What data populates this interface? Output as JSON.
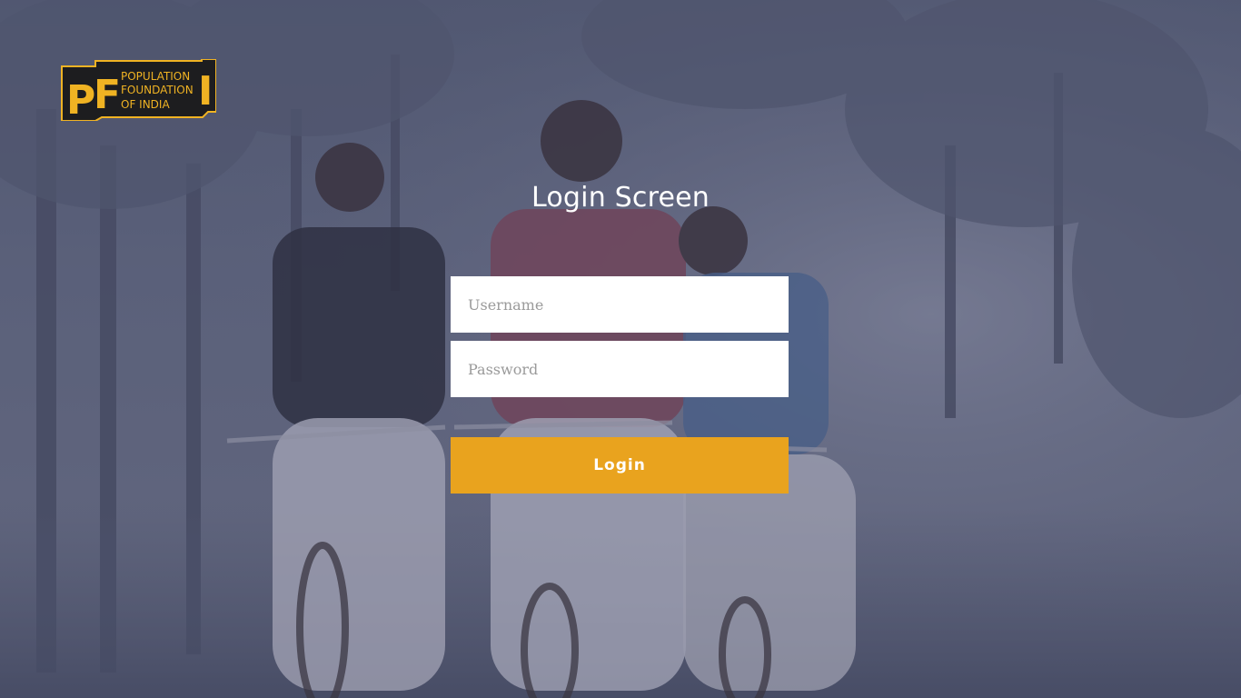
{
  "logo": {
    "letters": [
      "P",
      "F",
      "I"
    ],
    "lines": [
      "POPULATION",
      "FOUNDATION",
      "OF INDIA"
    ]
  },
  "page": {
    "title": "Login Screen"
  },
  "form": {
    "username_placeholder": "Username",
    "password_placeholder": "Password",
    "login_label": "Login"
  },
  "colors": {
    "accent": "#e9a31e",
    "logo_background": "#1d1d1f",
    "logo_text": "#f0b323"
  }
}
